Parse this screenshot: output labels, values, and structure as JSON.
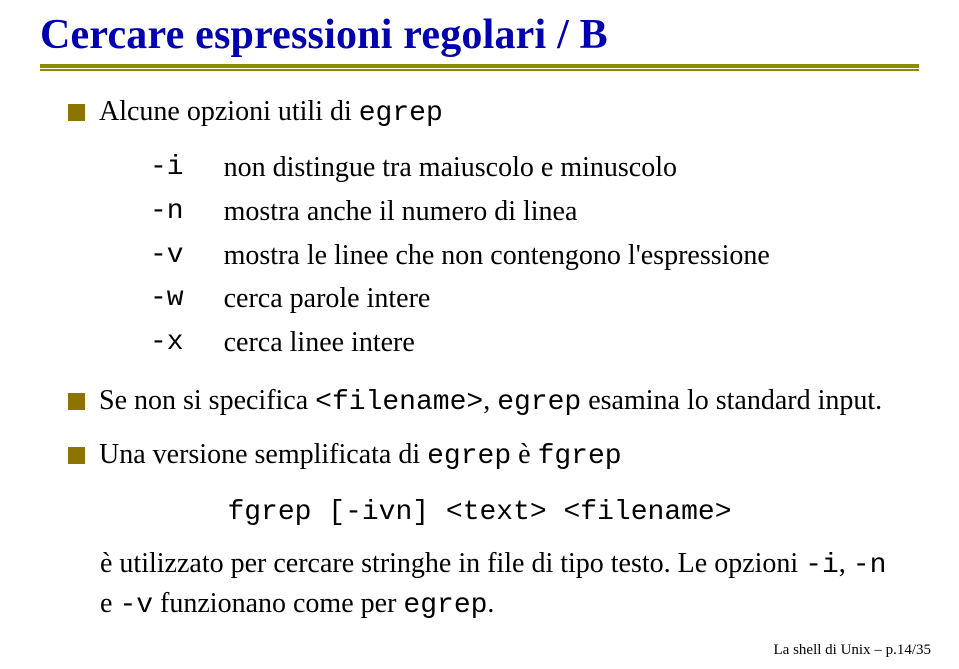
{
  "title": "Cercare espressioni regolari / B",
  "bullets": {
    "b1_pre": "Alcune opzioni utili di ",
    "b1_cmd": "egrep",
    "b2_pre": "Se non si specifica ",
    "b2_f": "<filename>",
    "b2_mid": ", ",
    "b2_cmd": "egrep",
    "b2_post": " esamina lo standard input.",
    "b3_pre": "Una versione semplificata di ",
    "b3_cmd1": "egrep",
    "b3_mid": " è ",
    "b3_cmd2": "fgrep"
  },
  "options": [
    {
      "flag": "-i",
      "desc": "non distingue tra maiuscolo e minuscolo"
    },
    {
      "flag": "-n",
      "desc": "mostra anche il numero di linea"
    },
    {
      "flag": "-v",
      "desc": "mostra le linee che non contengono l'espressione"
    },
    {
      "flag": "-w",
      "desc": "cerca parole intere"
    },
    {
      "flag": "-x",
      "desc": "cerca linee intere"
    }
  ],
  "code": "fgrep [-ivn] <text> <filename>",
  "tail": {
    "t1": "è utilizzato per cercare stringhe in file di tipo testo. Le opzioni ",
    "f1": "-i",
    "t2": ", ",
    "f2": "-n",
    "t3": "e ",
    "f3": "-v",
    "t4": " funzionano come per ",
    "cmd": "egrep",
    "t5": "."
  },
  "footer": "La shell di Unix – p.14/35"
}
